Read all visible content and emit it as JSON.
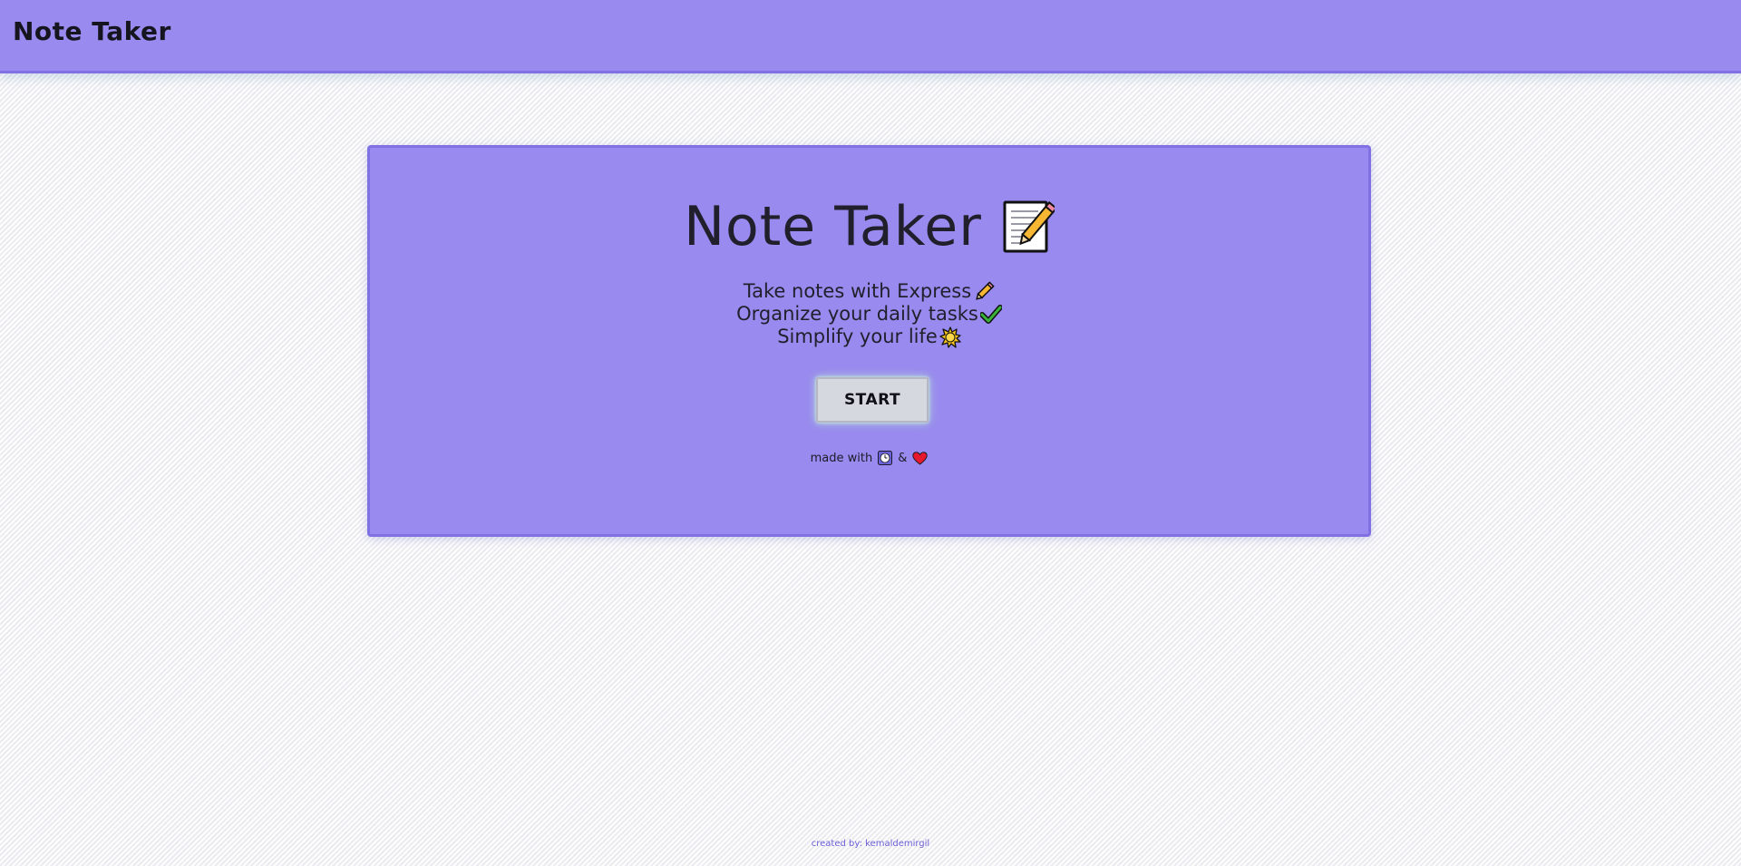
{
  "navbar": {
    "brand": "Note Taker"
  },
  "hero": {
    "title": "Note Taker",
    "title_icon": "memo-icon",
    "taglines": [
      {
        "text": "Take notes with Express",
        "icon": "pencil-icon"
      },
      {
        "text": "Organize your daily tasks",
        "icon": "check-mark-icon"
      },
      {
        "text": "Simplify your life",
        "icon": "sun-icon"
      }
    ],
    "start_label": "START",
    "made_with": {
      "prefix": "made with",
      "icon1": "clock-icon",
      "separator": "&",
      "icon2": "heart-icon"
    }
  },
  "footer": {
    "credit": "created by: kemaldemirgil"
  },
  "colors": {
    "accent": "#988aee",
    "accent_border": "#7f70e4",
    "button_bg": "#d6d8df",
    "footer_text": "#6c5fd8"
  }
}
